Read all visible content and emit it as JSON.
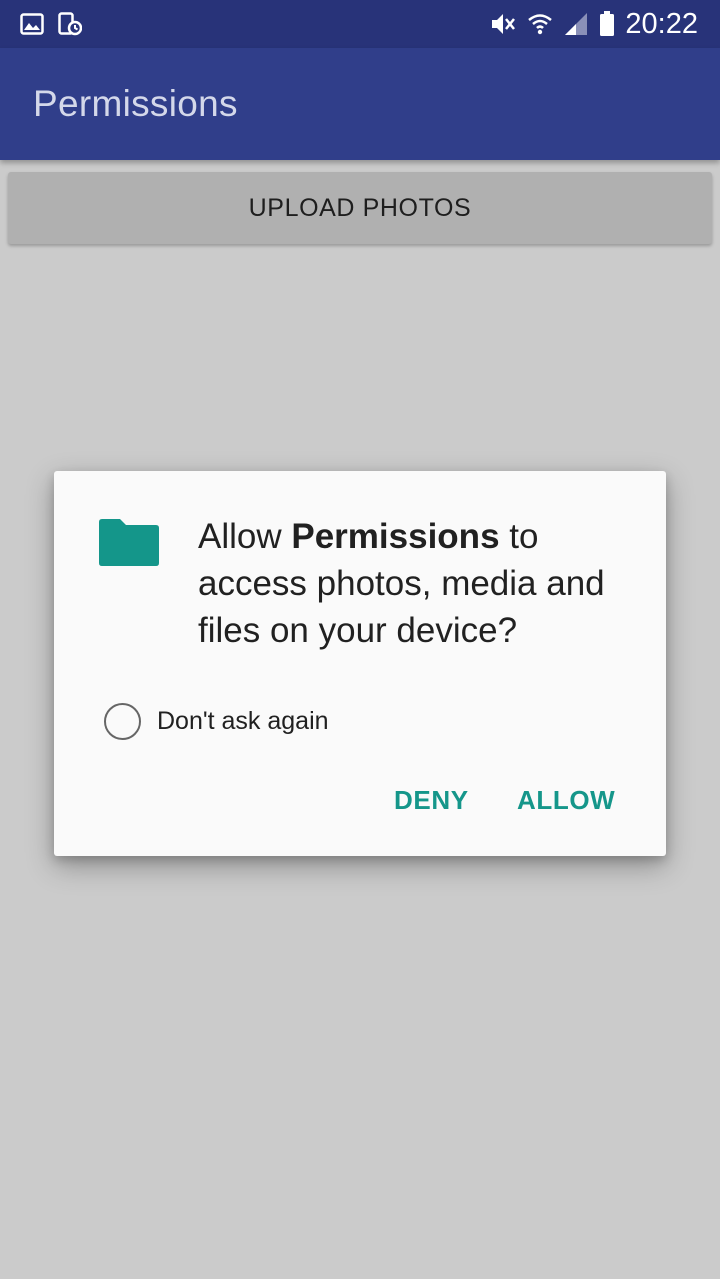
{
  "status_bar": {
    "time": "20:22",
    "left_icons": [
      "gallery-notification-icon",
      "phone-sync-icon"
    ],
    "right_icons": [
      "mute-icon",
      "wifi-icon",
      "signal-icon",
      "battery-icon"
    ]
  },
  "app_bar": {
    "title": "Permissions"
  },
  "main": {
    "upload_button_label": "UPLOAD PHOTOS"
  },
  "dialog": {
    "icon": "folder-icon",
    "message_prefix": "Allow ",
    "message_app_name": "Permissions",
    "message_suffix": " to access photos, media and files on your device?",
    "dont_ask_label": "Don't ask again",
    "deny_label": "DENY",
    "allow_label": "ALLOW"
  },
  "colors": {
    "status_bar": "#283379",
    "app_bar": "#303e8a",
    "accent": "#15968a",
    "background": "#cbcbcb"
  }
}
